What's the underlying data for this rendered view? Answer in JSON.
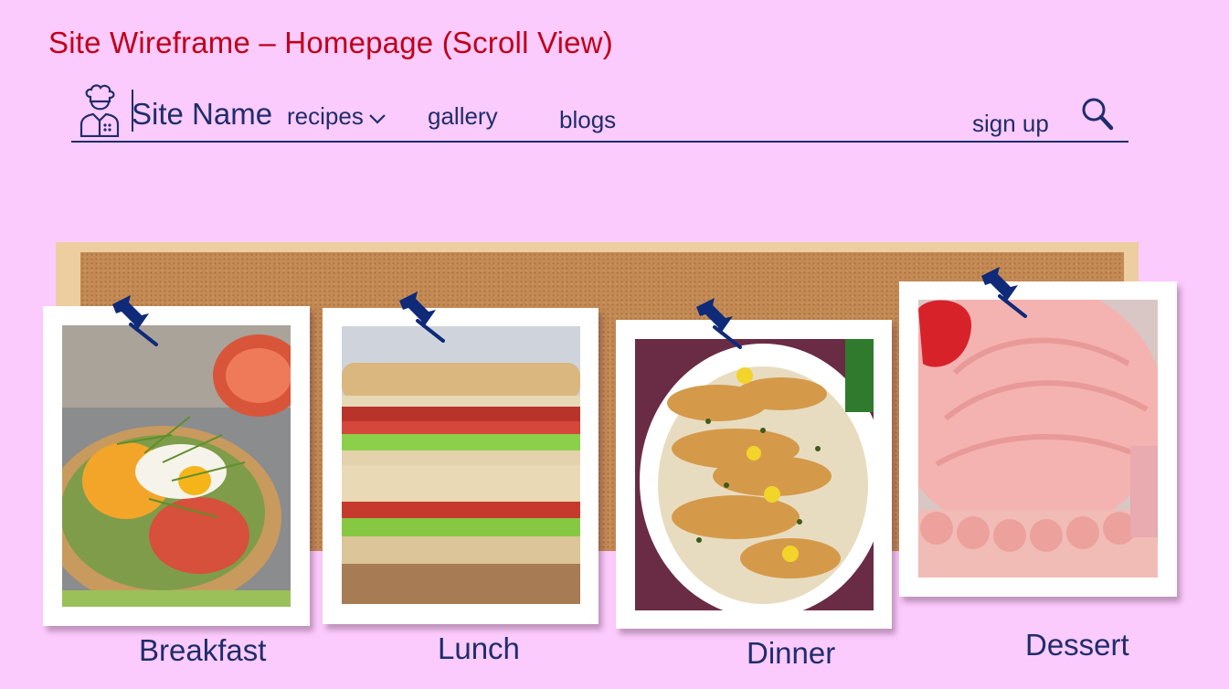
{
  "page": {
    "title": "Site Wireframe – Homepage (Scroll View)"
  },
  "nav": {
    "site_name": "Site Name",
    "links": {
      "recipes": "recipes",
      "gallery": "gallery",
      "blogs": "blogs",
      "signup": "sign up"
    },
    "icons": [
      "chef-icon",
      "chevron-down-icon",
      "search-icon"
    ]
  },
  "colors": {
    "background": "#fccbfd",
    "title": "#c0001b",
    "navy": "#1f2d6b",
    "cork": "#c48a55",
    "frame": "#eccea0",
    "pin": "#0f2a78"
  },
  "categories": [
    {
      "caption": "Breakfast",
      "image": "avocado toast with tomatoes, egg and microgreens"
    },
    {
      "caption": "Lunch",
      "image": "BLT club sandwich"
    },
    {
      "caption": "Dinner",
      "image": "chicken piccata with capers and lemon"
    },
    {
      "caption": "Dessert",
      "image": "pink frosted strawberry cake"
    }
  ]
}
